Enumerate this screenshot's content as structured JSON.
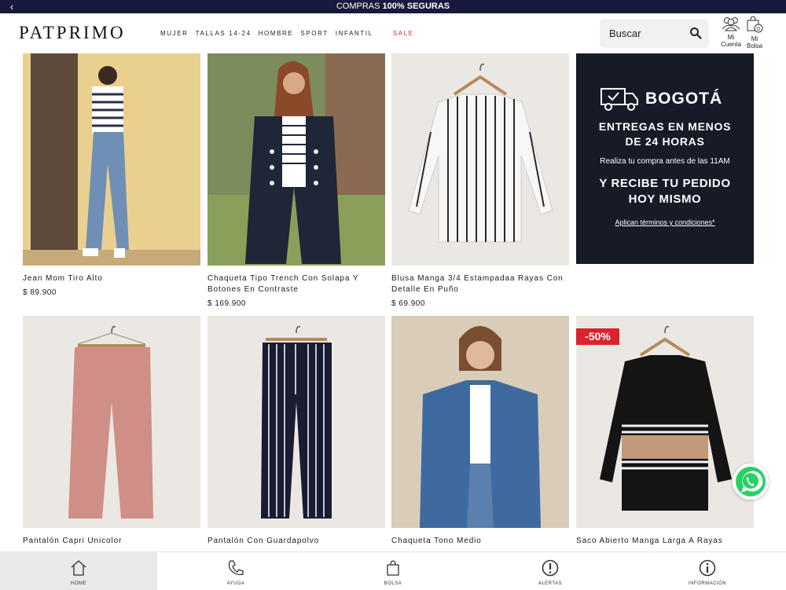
{
  "topbar": {
    "text_prefix": "COMPRAS ",
    "text_bold": "100% SEGURAS"
  },
  "header": {
    "logo": "PATPRIMO",
    "nav": [
      "MUJER",
      "TALLAS 14-24",
      "HOMBRE",
      "SPORT",
      "INFANTIL"
    ],
    "sale": "SALE",
    "search_placeholder": "Buscar",
    "account_line1": "Mi",
    "account_line2": "Cuenta",
    "bag_line1": "Mi",
    "bag_line2": "Bolsa",
    "bag_count": "0"
  },
  "products": [
    {
      "name": "Jean Mom Tiro Alto",
      "price": "$ 89.900"
    },
    {
      "name": "Chaqueta Tipo Trench Con Solapa Y Botones En Contraste",
      "price": "$ 169.900"
    },
    {
      "name": "Blusa Manga 3/4 Estampadaa Rayas Con Detalle En Puño",
      "price": "$ 69.900"
    },
    {
      "name": "Pantalón Capri Unicolor"
    },
    {
      "name": "Pantalón Con Guardapolvo"
    },
    {
      "name": "Chaqueta Tono Medio"
    },
    {
      "name": "Saco Abierto Manga Larga A Rayas",
      "badge": "-50%"
    }
  ],
  "promo": {
    "city": "BOGOTÁ",
    "line1a": "ENTREGAS EN MENOS",
    "line1b": "DE 24 HORAS",
    "line2": "Realiza tu compra antes de las 11AM",
    "line3a": "Y RECIBE TU PEDIDO",
    "line3b": "HOY MISMO",
    "terms": "Aplican términos y condiciones*"
  },
  "tabbar": [
    "HOME",
    "AYUDA",
    "BOLSA",
    "ALERTAS",
    "INFORMACIÓN"
  ],
  "colors": {
    "topbar": "#171a3a",
    "sale": "#d9232e",
    "promo_bg": "#161b27",
    "whatsapp": "#25d366"
  }
}
